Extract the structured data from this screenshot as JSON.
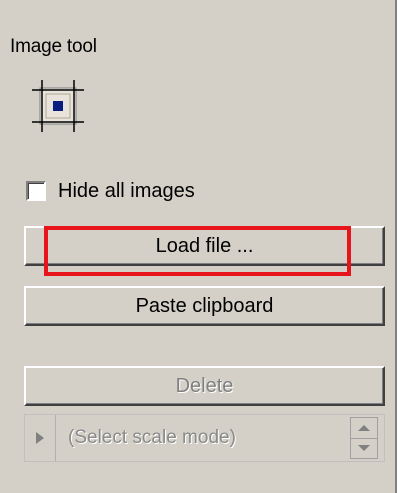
{
  "panel": {
    "title": "Image tool",
    "tool_icon": "image-frame-icon",
    "hide_all_images": {
      "label": "Hide all images",
      "checked": false
    },
    "buttons": {
      "load_file": "Load file ...",
      "paste_clipboard": "Paste clipboard",
      "delete": "Delete"
    },
    "scale_mode": {
      "placeholder": "(Select scale mode)"
    }
  },
  "highlight_color": "#e8141c"
}
